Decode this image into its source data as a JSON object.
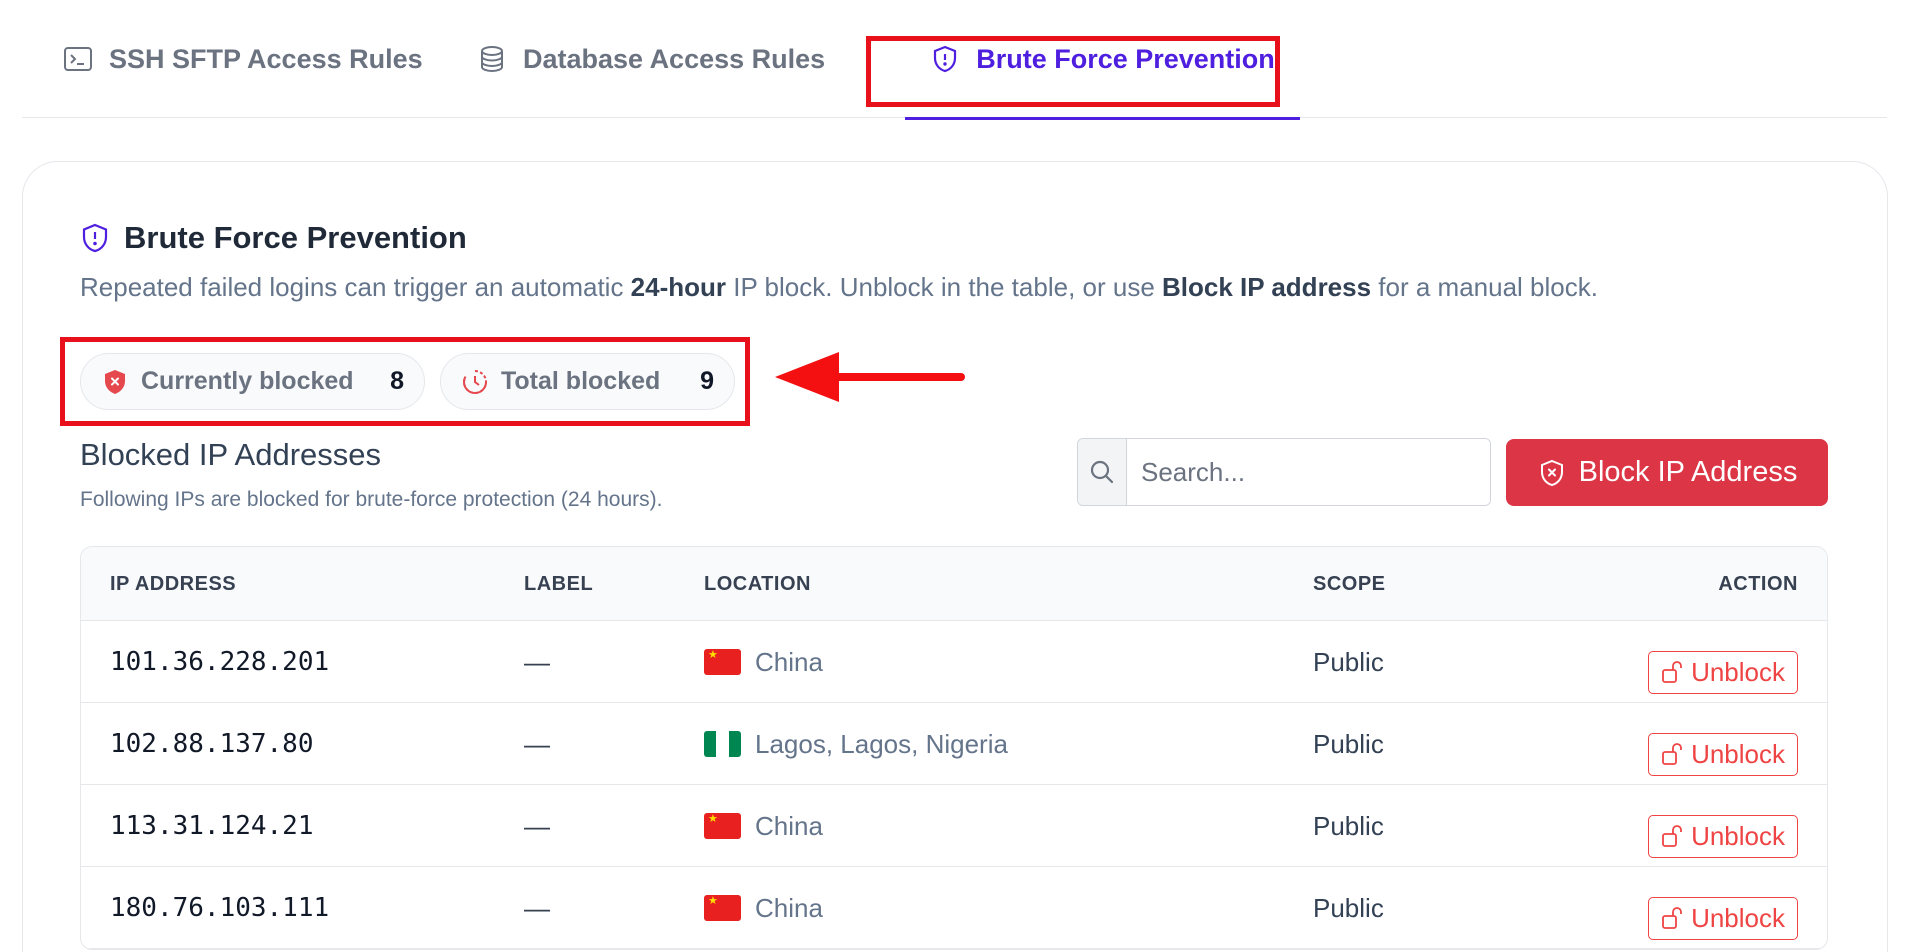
{
  "tabs": [
    {
      "label": "SSH SFTP Access Rules",
      "icon": "terminal-icon"
    },
    {
      "label": "Database Access Rules",
      "icon": "database-icon"
    },
    {
      "label": "Brute Force Prevention",
      "icon": "shield-alert-icon",
      "active": true
    }
  ],
  "section": {
    "title": "Brute Force Prevention",
    "description_pre": "Repeated failed logins can trigger an automatic ",
    "description_bold1": "24-hour",
    "description_mid": " IP block. Unblock in the table, or use ",
    "description_bold2": "Block IP address",
    "description_post": " for a manual block."
  },
  "stats": {
    "currently_blocked_label": "Currently blocked",
    "currently_blocked_value": "8",
    "total_blocked_label": "Total blocked",
    "total_blocked_value": "9"
  },
  "table_header": {
    "title": "Blocked IP Addresses",
    "subtitle": "Following IPs are blocked for brute-force protection (24 hours)."
  },
  "search": {
    "placeholder": "Search..."
  },
  "block_button": {
    "label": "Block IP Address"
  },
  "columns": {
    "ip": "IP ADDRESS",
    "label": "LABEL",
    "location": "LOCATION",
    "scope": "SCOPE",
    "action": "ACTION"
  },
  "rows": [
    {
      "ip": "101.36.228.201",
      "label": "—",
      "location": "China",
      "flag": "cn",
      "scope": "Public",
      "action": "Unblock"
    },
    {
      "ip": "102.88.137.80",
      "label": "—",
      "location": "Lagos, Lagos, Nigeria",
      "flag": "ng",
      "scope": "Public",
      "action": "Unblock"
    },
    {
      "ip": "113.31.124.21",
      "label": "—",
      "location": "China",
      "flag": "cn",
      "scope": "Public",
      "action": "Unblock"
    },
    {
      "ip": "180.76.103.111",
      "label": "—",
      "location": "China",
      "flag": "cn",
      "scope": "Public",
      "action": "Unblock"
    }
  ],
  "colors": {
    "accent": "#4f1fe0",
    "danger": "#dc3545",
    "highlight": "#e8111b"
  }
}
